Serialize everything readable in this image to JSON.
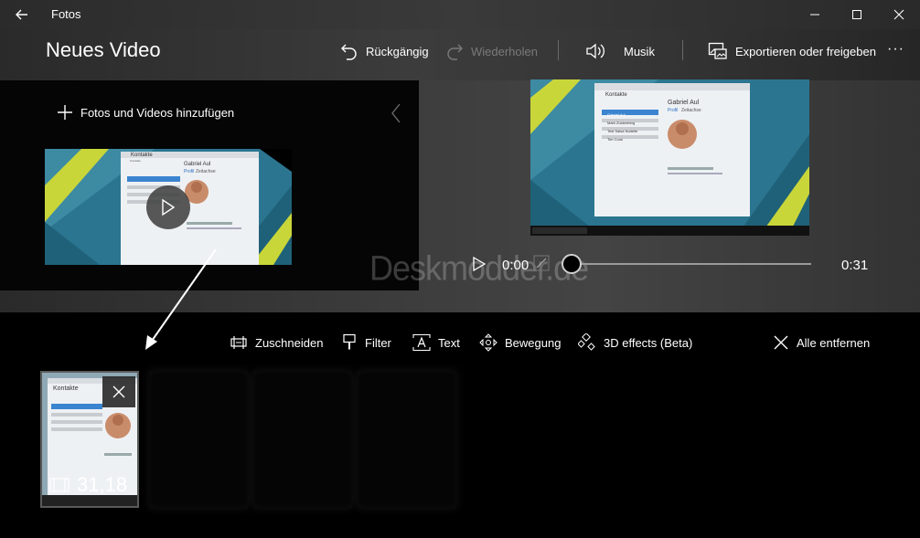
{
  "window": {
    "app_title": "Fotos"
  },
  "header": {
    "page_title": "Neues Video",
    "undo_label": "Rückgängig",
    "redo_label": "Wiederholen",
    "music_label": "Musik",
    "export_label": "Exportieren oder freigeben",
    "more_label": "···"
  },
  "library": {
    "add_label": "Fotos und Videos hinzufügen"
  },
  "thumb_screen": {
    "app_name": "Kontakte",
    "contact_name": "Gabriel Aul",
    "tab_profile": "Profil",
    "tab_timeline": "Zeitachse",
    "list": [
      "Gabriel Aul",
      "Mark Zuckerberg",
      "Test Salsa Nudelle",
      "Tim Cook"
    ]
  },
  "player": {
    "current_time": "0:00",
    "end_time": "0:31",
    "progress": 0
  },
  "watermark": "Deskmodder.de",
  "storyboard": {
    "tools": {
      "trim": "Zuschneiden",
      "filter": "Filter",
      "text": "Text",
      "motion": "Bewegung",
      "effects3d": "3D effects (Beta)",
      "remove_all": "Alle entfernen"
    },
    "card": {
      "duration": "31,18"
    }
  }
}
